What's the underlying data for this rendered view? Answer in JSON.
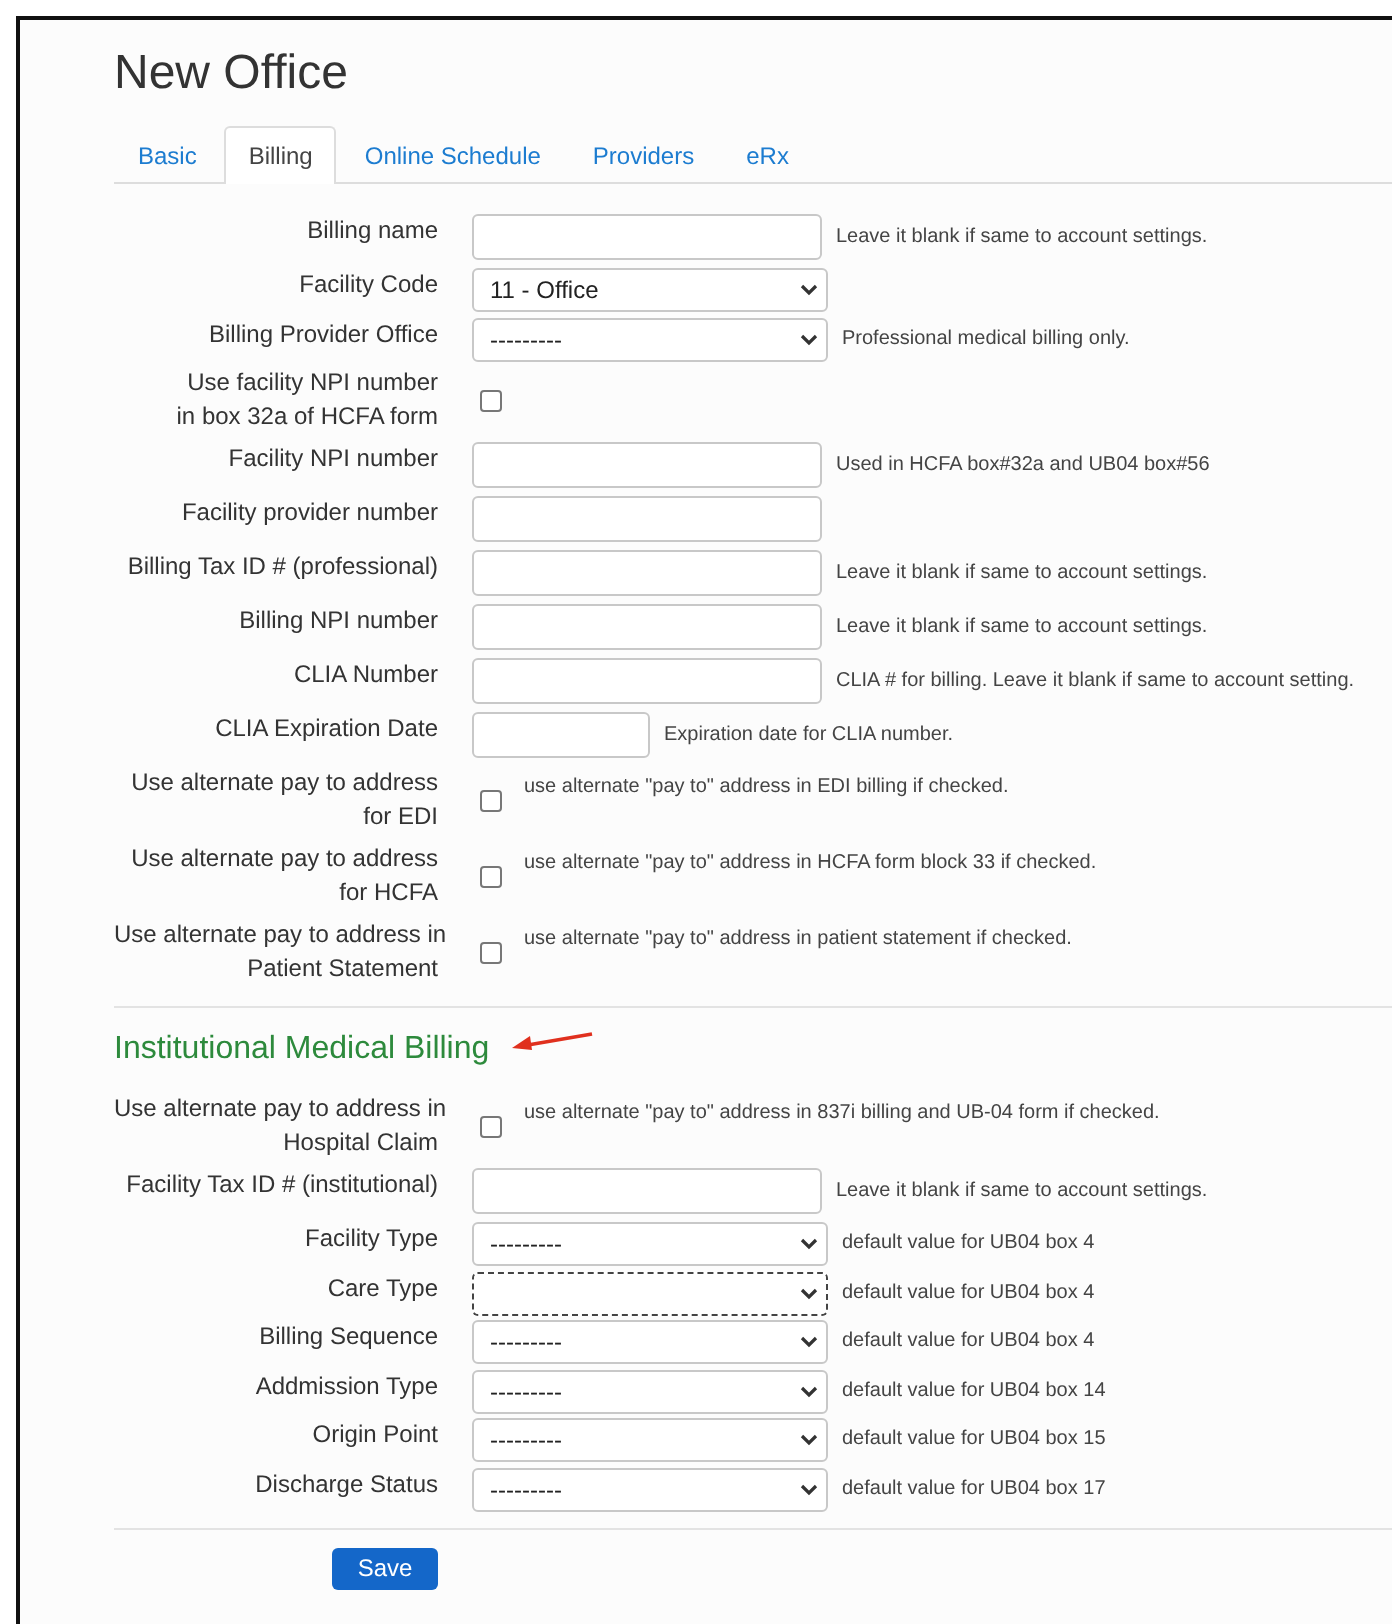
{
  "page": {
    "title": "New Office"
  },
  "tabs": [
    {
      "label": "Basic",
      "selected": false
    },
    {
      "label": "Billing",
      "selected": true
    },
    {
      "label": "Online Schedule",
      "selected": false
    },
    {
      "label": "Providers",
      "selected": false
    },
    {
      "label": "eRx",
      "selected": false
    }
  ],
  "billing_rows": [
    {
      "kind": "text",
      "label": "Billing name",
      "hint": "Leave it blank if same to account settings."
    },
    {
      "kind": "select",
      "label": "Facility Code",
      "value": "11 - Office",
      "focused": false
    },
    {
      "kind": "select",
      "label": "Billing Provider Office",
      "value": "---------",
      "focused": false,
      "hint": "Professional medical billing only."
    },
    {
      "kind": "checkbox",
      "label": "Use facility NPI number\nin box 32a of HCFA form",
      "checked": false
    },
    {
      "kind": "text",
      "label": "Facility NPI number",
      "hint": "Used in HCFA box#32a and UB04 box#56"
    },
    {
      "kind": "text",
      "label": "Facility provider number"
    },
    {
      "kind": "text",
      "label": "Billing Tax ID # (professional)",
      "hint": "Leave it blank if same to account settings."
    },
    {
      "kind": "text",
      "label": "Billing NPI number",
      "hint": "Leave it blank if same to account settings."
    },
    {
      "kind": "text",
      "label": "CLIA Number",
      "hint": "CLIA # for billing. Leave it blank if same to account setting."
    },
    {
      "kind": "date",
      "label": "CLIA Expiration Date",
      "hint": "Expiration date for CLIA number."
    },
    {
      "kind": "checkbox",
      "label": "Use alternate pay to address\nfor EDI",
      "checked": false,
      "hint": "use alternate \"pay to\" address in EDI billing if checked."
    },
    {
      "kind": "checkbox",
      "label": "Use alternate pay to address\nfor HCFA",
      "checked": false,
      "hint": "use alternate \"pay to\" address in HCFA form block 33 if checked."
    },
    {
      "kind": "checkbox",
      "label": "Use alternate pay to address in\nPatient Statement",
      "checked": false,
      "hint": "use alternate \"pay to\" address in patient statement if checked."
    }
  ],
  "institutional": {
    "heading": "Institutional Medical Billing",
    "rows": [
      {
        "kind": "checkbox",
        "label": "Use alternate pay to address in\nHospital Claim",
        "checked": false,
        "hint": "use alternate \"pay to\" address in 837i billing and UB-04 form if checked."
      },
      {
        "kind": "text",
        "label": "Facility Tax ID # (institutional)",
        "hint": "Leave it blank if same to account settings."
      },
      {
        "kind": "select",
        "label": "Facility Type",
        "value": "---------",
        "focused": false,
        "hint": "default value for UB04 box 4"
      },
      {
        "kind": "select",
        "label": "Care Type",
        "focused": true,
        "hint": "default value for UB04 box 4"
      },
      {
        "kind": "select",
        "label": "Billing Sequence",
        "value": "---------",
        "focused": false,
        "hint": "default value for UB04 box 4"
      },
      {
        "kind": "select",
        "label": "Addmission Type",
        "value": "---------",
        "focused": false,
        "hint": "default value for UB04 box 14"
      },
      {
        "kind": "select",
        "label": "Origin Point",
        "value": "---------",
        "focused": false,
        "hint": "default value for UB04 box 15"
      },
      {
        "kind": "select",
        "label": "Discharge Status",
        "value": "---------",
        "focused": false,
        "hint": "default value for UB04 box 17"
      }
    ]
  },
  "save_button": "Save"
}
